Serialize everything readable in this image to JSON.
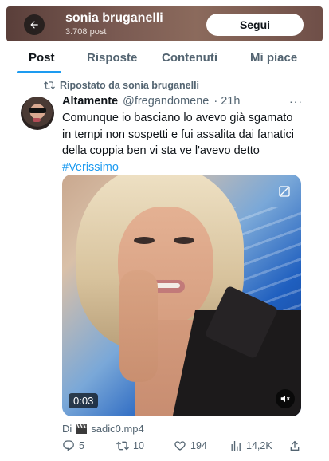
{
  "header": {
    "title": "sonia bruganelli",
    "subtitle": "3.708 post",
    "follow_label": "Segui"
  },
  "tabs": [
    {
      "label": "Post",
      "active": true
    },
    {
      "label": "Risposte",
      "active": false
    },
    {
      "label": "Contenuti",
      "active": false
    },
    {
      "label": "Mi piace",
      "active": false
    }
  ],
  "repost": {
    "text": "Ripostato da sonia bruganelli"
  },
  "tweet": {
    "name": "Altamente",
    "handle": "@fregandomene",
    "time": "· 21h",
    "more": "···",
    "lines": [
      "Comunque io basciano lo avevo già sgamato",
      "in tempi non sospetti e fui assalita dai fanatici",
      "della coppia ben vi sta ve l'avevo detto"
    ],
    "hashtag": "#Verissimo",
    "media": {
      "duration": "0:03"
    },
    "source_prefix": "Di",
    "source_name": "sadic0.mp4",
    "stats": {
      "replies": "5",
      "reposts": "10",
      "likes": "194",
      "views": "14,2K"
    }
  },
  "colors": {
    "accent": "#1d9bf0",
    "text": "#0f1419",
    "muted": "#536471"
  },
  "icons": [
    "back-arrow-icon",
    "repost-icon",
    "more-icon",
    "blur-toggle-icon",
    "mute-icon",
    "clapper-icon",
    "reply-icon",
    "like-icon",
    "views-icon",
    "share-icon"
  ]
}
